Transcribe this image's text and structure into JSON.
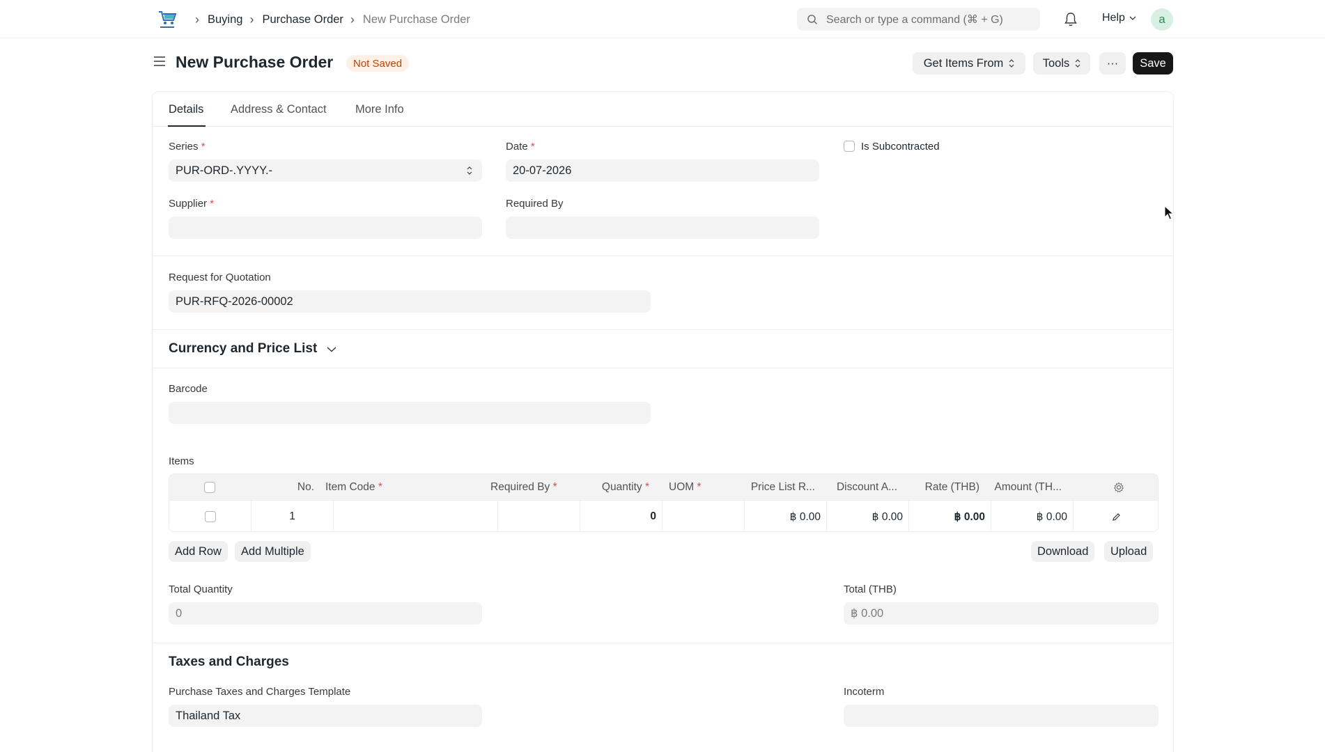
{
  "navbar": {
    "breadcrumbs": [
      "Buying",
      "Purchase Order",
      "New Purchase Order"
    ],
    "search_placeholder": "Search or type a command (⌘ + G)",
    "help_label": "Help",
    "avatar_initial": "a"
  },
  "header": {
    "title": "New Purchase Order",
    "status": "Not Saved",
    "get_items_label": "Get Items From",
    "tools_label": "Tools",
    "more_label": "···",
    "save_label": "Save"
  },
  "tabs": [
    {
      "label": "Details",
      "active": true
    },
    {
      "label": "Address & Contact",
      "active": false
    },
    {
      "label": "More Info",
      "active": false
    }
  ],
  "form": {
    "series_label": "Series",
    "series_value": "PUR-ORD-.YYYY.-",
    "date_label": "Date",
    "date_value": "20-07-2026",
    "subcontracted_label": "Is Subcontracted",
    "supplier_label": "Supplier",
    "supplier_value": "",
    "required_by_label": "Required By",
    "required_by_value": "",
    "rfq_label": "Request for Quotation",
    "rfq_value": "PUR-RFQ-2026-00002",
    "currency_section": "Currency and Price List",
    "barcode_label": "Barcode",
    "barcode_value": "",
    "items_label": "Items",
    "total_qty_label": "Total Quantity",
    "total_qty_value": "0",
    "total_label": "Total (THB)",
    "total_value": "฿ 0.00",
    "taxes_section": "Taxes and Charges",
    "tax_template_label": "Purchase Taxes and Charges Template",
    "tax_template_value": "Thailand Tax",
    "incoterm_label": "Incoterm",
    "incoterm_value": ""
  },
  "items_table": {
    "columns": [
      "No.",
      "Item Code",
      "Required By",
      "Quantity",
      "UOM",
      "Price List R...",
      "Discount A...",
      "Rate (THB)",
      "Amount (TH..."
    ],
    "rows": [
      {
        "no": "1",
        "item_code": "",
        "required_by": "",
        "quantity": "0",
        "uom": "",
        "price_list_rate": "฿ 0.00",
        "discount_amount": "฿ 0.00",
        "rate": "฿ 0.00",
        "amount": "฿ 0.00"
      }
    ],
    "add_row_label": "Add Row",
    "add_multiple_label": "Add Multiple",
    "download_label": "Download",
    "upload_label": "Upload"
  },
  "colors": {
    "primary_button": "#171717",
    "badge_bg": "#fff0e6",
    "badge_text": "#c2410c",
    "required_mark": "#e24c4c"
  }
}
